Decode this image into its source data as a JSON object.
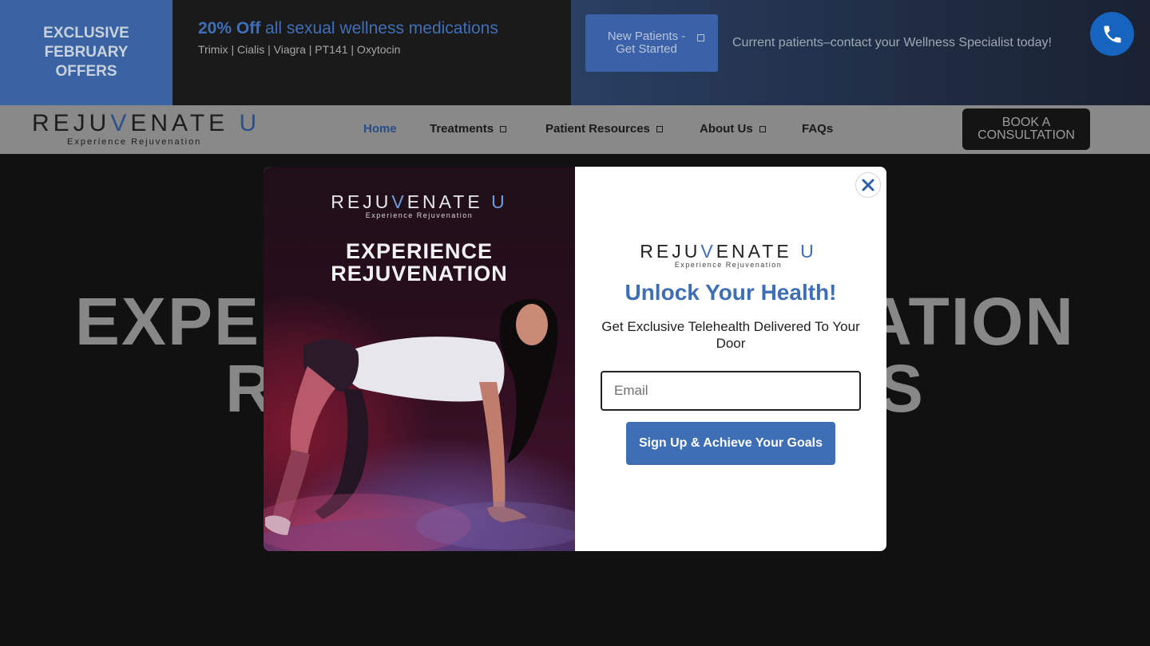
{
  "promo": {
    "left_label": "EXCLUSIVE\nFEBRUARY\nOFFERS",
    "headline_bold": "20% Off",
    "headline_rest": " all sexual wellness medications",
    "subline": "Trimix | Cialis | Viagra | PT141 | Oxytocin",
    "new_patients_button": "New Patients -\nGet Started",
    "current_patients_text": "Current patients–contact your Wellness Specialist today!",
    "colors": {
      "accent": "#3a63a3",
      "phone": "#1565c0"
    }
  },
  "nav": {
    "logo_word_1": "REJU",
    "logo_v": "V",
    "logo_word_2": "ENATE ",
    "logo_u": "U",
    "logo_tagline": "Experience Rejuvenation",
    "items": [
      {
        "label": "Home",
        "active": true,
        "has_dropdown": false
      },
      {
        "label": "Treatments",
        "active": false,
        "has_dropdown": true
      },
      {
        "label": "Patient Resources",
        "active": false,
        "has_dropdown": true
      },
      {
        "label": "About Us",
        "active": false,
        "has_dropdown": true
      },
      {
        "label": "FAQs",
        "active": false,
        "has_dropdown": false
      }
    ],
    "book_button": "BOOK A\nCONSULTATION"
  },
  "hero": {
    "line_1_left": "EXPE",
    "line_1_right": "ATION",
    "line_2_left": "R",
    "line_2_right": "S"
  },
  "modal": {
    "image_logo_word_1": "REJU",
    "image_logo_v": "V",
    "image_logo_word_2": "ENATE ",
    "image_logo_u": "U",
    "image_logo_tagline": "Experience Rejuvenation",
    "image_headline": "EXPERIENCE\nREJUVENATION",
    "form_logo_word_1": "REJU",
    "form_logo_v": "V",
    "form_logo_word_2": "ENATE ",
    "form_logo_u": "U",
    "form_logo_tagline": "Experience Rejuvenation",
    "title": "Unlock Your Health!",
    "subtitle": "Get Exclusive Telehealth Delivered To Your Door",
    "email_placeholder": "Email",
    "email_value": "",
    "signup_button": "Sign Up & Achieve Your Goals",
    "close_icon": "close-icon",
    "brand_color": "#3e6fb5"
  }
}
